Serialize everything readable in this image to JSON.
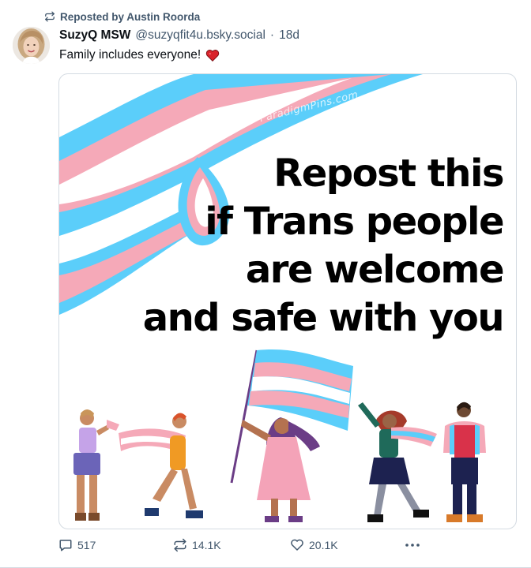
{
  "repost": {
    "label": "Reposted by Austin Roorda",
    "icon": "repost-icon"
  },
  "author": {
    "display_name": "SuzyQ MSW",
    "handle": "@suzyqfit4u.bsky.social",
    "separator": "·",
    "age": "18d"
  },
  "post": {
    "text": "Family includes everyone!",
    "emoji": "red-heart-icon"
  },
  "image": {
    "watermark": "ParadigmPins.com",
    "headline": [
      "Repost this",
      "if Trans people",
      "are welcome",
      "and safe with you"
    ],
    "colors": {
      "trans_blue": "#5bcefa",
      "trans_pink": "#f5a9b8",
      "white": "#ffffff"
    }
  },
  "actions": {
    "reply_count": "517",
    "repost_count": "14.1K",
    "like_count": "20.1K",
    "more_icon": "ellipsis-icon"
  },
  "colors": {
    "muted": "#42576c",
    "border": "#d4dbe2",
    "heart": "#e0245e"
  }
}
